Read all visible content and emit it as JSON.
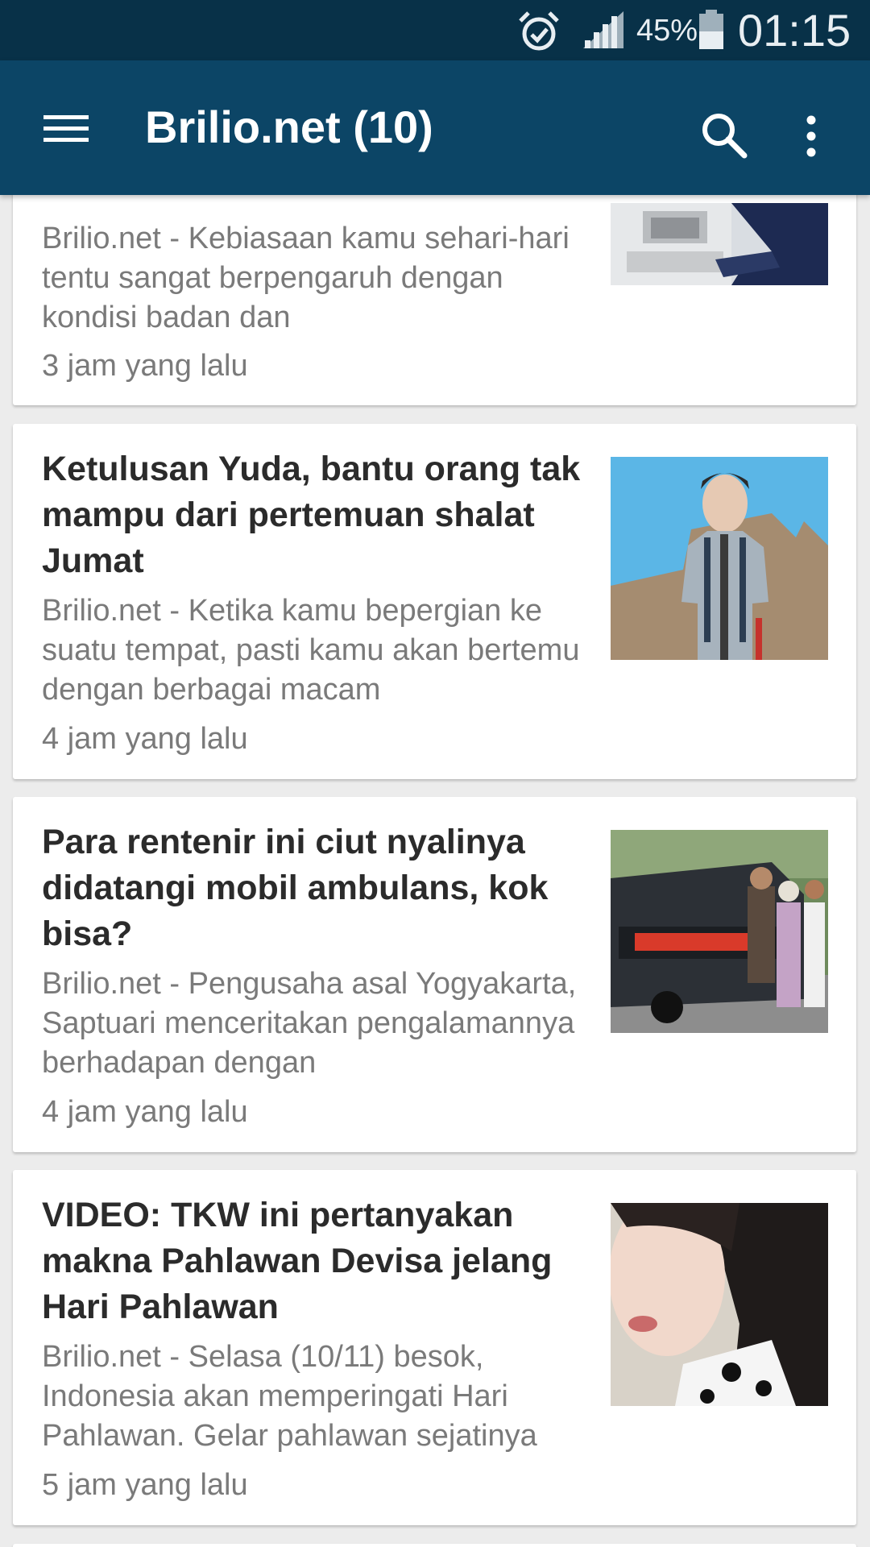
{
  "status_bar": {
    "battery_percent": "45%",
    "clock": "01:15",
    "icons": [
      "alarm-icon",
      "signal-icon",
      "battery-icon"
    ]
  },
  "app_bar": {
    "title": "Brilio.net (10)",
    "icons": [
      "menu-icon",
      "search-icon",
      "more-vert-icon"
    ],
    "background": "#0c4566"
  },
  "articles": [
    {
      "headline": "",
      "summary": "Brilio.net - Kebiasaan kamu sehari-hari tentu sangat berpengaruh dengan kondisi badan dan",
      "time": "3 jam yang lalu"
    },
    {
      "headline": "Ketulusan Yuda, bantu orang tak mampu dari pertemuan shalat Jumat",
      "summary": "Brilio.net - Ketika kamu bepergian ke suatu tempat, pasti kamu akan bertemu dengan berbagai macam",
      "time": "4 jam yang lalu"
    },
    {
      "headline": "Para rentenir ini ciut nyalinya didatangi mobil ambulans, kok bisa?",
      "summary": "Brilio.net - Pengusaha asal Yogyakarta, Saptuari menceritakan pengalamannya berhadapan dengan",
      "time": "4 jam yang lalu"
    },
    {
      "headline": "VIDEO: TKW ini pertanyakan makna Pahlawan Devisa jelang Hari Pahlawan",
      "summary": "Brilio.net - Selasa (10/11) besok, Indonesia akan memperingati Hari Pahlawan. Gelar pahlawan sejatinya",
      "time": "5 jam yang lalu"
    }
  ]
}
